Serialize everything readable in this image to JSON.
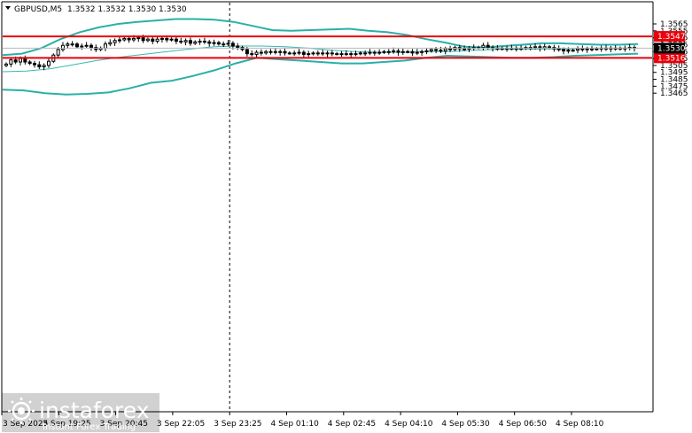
{
  "header": {
    "symbol_label": "GBPUSD,M5",
    "ohlc_label": "1.3532 1.3532 1.3530 1.3530"
  },
  "levels": [
    {
      "value": 1.3547,
      "label": "1.3547",
      "color": "#e8000b"
    },
    {
      "value": 1.3516,
      "label": "1.3516",
      "color": "#e8000b"
    }
  ],
  "current_price": {
    "value": 1.353,
    "label": "1.3530",
    "color": "#000000"
  },
  "colors": {
    "band": "#2ab0a8",
    "ma": "#37b8b0",
    "candle": "#000000",
    "level": "#e8000b",
    "grid": "#c8c8c8"
  },
  "logo": {
    "brand": "instaforex",
    "tagline": "Instant Forex Trading",
    "icon": "instaforex-sun-icon"
  },
  "chart_data": {
    "type": "candlestick",
    "title": "GBPUSD,M5",
    "timeframe": "M5",
    "ylim": [
      1.3462,
      1.3572
    ],
    "y_ticks": [
      "1.3565",
      "1.3555",
      "1.3545",
      "1.3535",
      "1.3525",
      "1.3515",
      "1.3505",
      "1.3495",
      "1.3485",
      "1.3475",
      "1.3465"
    ],
    "x_ticks": [
      "3 Sep 2025",
      "3 Sep 19:25",
      "3 Sep 20:45",
      "3 Sep 22:05",
      "3 Sep 23:25",
      "4 Sep 01:10",
      "4 Sep 02:45",
      "4 Sep 04:10",
      "4 Sep 05:30",
      "4 Sep 06:50",
      "4 Sep 08:10"
    ],
    "session_separator": "3 Sep 23:25",
    "grid": false,
    "candle_closes": [
      1.3507,
      1.3513,
      1.351,
      1.3515,
      1.351,
      1.3508,
      1.3506,
      1.3503,
      1.3505,
      1.3511,
      1.352,
      1.3528,
      1.3534,
      1.3536,
      1.3536,
      1.3532,
      1.3533,
      1.3534,
      1.3531,
      1.3528,
      1.353,
      1.3536,
      1.3538,
      1.3541,
      1.3542,
      1.3544,
      1.3542,
      1.3544,
      1.3545,
      1.3541,
      1.3543,
      1.354,
      1.3543,
      1.3544,
      1.3542,
      1.3543,
      1.354,
      1.3539,
      1.3541,
      1.3537,
      1.3539,
      1.354,
      1.3539,
      1.3537,
      1.3538,
      1.3536,
      1.3536,
      1.3537,
      1.3533,
      1.3531,
      1.3528,
      1.3522,
      1.3521,
      1.3524,
      1.3523,
      1.3525,
      1.3525,
      1.3524,
      1.3525,
      1.3523,
      1.3523,
      1.3523,
      1.3524,
      1.3521,
      1.3522,
      1.3523,
      1.3523,
      1.3522,
      1.3523,
      1.3522,
      1.3522,
      1.3522,
      1.3522,
      1.3522,
      1.3522,
      1.3523,
      1.3523,
      1.3524,
      1.3524,
      1.3524,
      1.3525,
      1.3525,
      1.3526,
      1.3524,
      1.3525,
      1.3525,
      1.3523,
      1.3524,
      1.3525,
      1.3526,
      1.3528,
      1.3527,
      1.3526,
      1.3529,
      1.3528,
      1.3531,
      1.3529,
      1.3529,
      1.353,
      1.3531,
      1.3531,
      1.3534,
      1.3531,
      1.353,
      1.353,
      1.3529,
      1.353,
      1.353,
      1.353,
      1.353,
      1.3531,
      1.3531,
      1.3532,
      1.353,
      1.3532,
      1.3531,
      1.3529,
      1.3528,
      1.3526,
      1.3527,
      1.3527,
      1.3529,
      1.3528,
      1.3529,
      1.3529,
      1.3529,
      1.353,
      1.3529,
      1.353,
      1.353,
      1.3529,
      1.353,
      1.3531,
      1.353
    ],
    "bollinger_upper": [
      1.352,
      1.3522,
      1.353,
      1.3543,
      1.3553,
      1.356,
      1.3565,
      1.3568,
      1.357,
      1.3572,
      1.3572,
      1.3571,
      1.3568,
      1.3562,
      1.3556,
      1.3555,
      1.3556,
      1.3557,
      1.3558,
      1.3555,
      1.3553,
      1.3549,
      1.3543,
      1.3538,
      1.3532,
      1.3531,
      1.3533,
      1.3535,
      1.3537,
      1.3537,
      1.3536,
      1.3535,
      1.3535,
      1.3536
    ],
    "bollinger_lower": [
      1.347,
      1.3469,
      1.3465,
      1.3463,
      1.3464,
      1.3466,
      1.3472,
      1.348,
      1.3483,
      1.349,
      1.3498,
      1.3508,
      1.3516,
      1.3514,
      1.3512,
      1.351,
      1.3508,
      1.3508,
      1.351,
      1.3512,
      1.3516,
      1.3519,
      1.3518,
      1.3517,
      1.3516,
      1.3516,
      1.3517,
      1.3519,
      1.352,
      1.3521,
      1.3522
    ],
    "moving_average": [
      1.3496,
      1.3497,
      1.35,
      1.3506,
      1.3512,
      1.3517,
      1.3521,
      1.3525,
      1.3529,
      1.3532,
      1.3533,
      1.3533,
      1.3532,
      1.353,
      1.3527,
      1.3525,
      1.3524,
      1.3524,
      1.3525,
      1.3525,
      1.3527,
      1.3528,
      1.3528,
      1.3529,
      1.3529,
      1.353,
      1.353,
      1.353
    ]
  }
}
